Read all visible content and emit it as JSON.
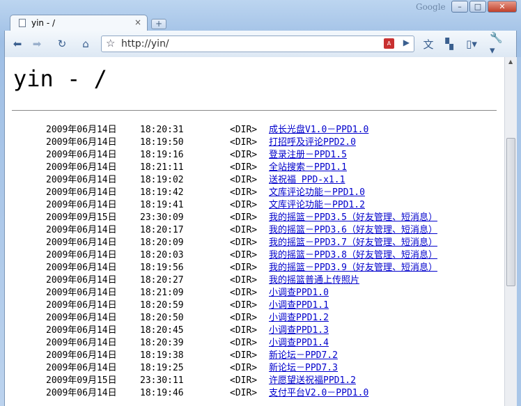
{
  "window": {
    "brand": "Google",
    "minimize": "–",
    "maximize": "□",
    "close": "✕"
  },
  "tab": {
    "title": "yin - /",
    "close": "×",
    "new_tab": "+"
  },
  "address": {
    "url": "http://yin/"
  },
  "page": {
    "title": "yin - /"
  },
  "entries": [
    {
      "date": "2009年06月14日",
      "time": "18:20:31",
      "type": "<DIR>",
      "name": "成长光盘V1.0－PPD1.0"
    },
    {
      "date": "2009年06月14日",
      "time": "18:19:50",
      "type": "<DIR>",
      "name": "打招呼及评论PPD2.0"
    },
    {
      "date": "2009年06月14日",
      "time": "18:19:16",
      "type": "<DIR>",
      "name": "登录注册－PPD1.5"
    },
    {
      "date": "2009年06月14日",
      "time": "18:21:11",
      "type": "<DIR>",
      "name": "全站搜索－PPD1.1"
    },
    {
      "date": "2009年06月14日",
      "time": "18:19:02",
      "type": "<DIR>",
      "name": "送祝福 PPD-x1.1"
    },
    {
      "date": "2009年06月14日",
      "time": "18:19:42",
      "type": "<DIR>",
      "name": "文库评论功能－PPD1.0"
    },
    {
      "date": "2009年06月14日",
      "time": "18:19:41",
      "type": "<DIR>",
      "name": "文库评论功能－PPD1.2"
    },
    {
      "date": "2009年09月15日",
      "time": "23:30:09",
      "type": "<DIR>",
      "name": "我的摇篮－PPD3.5（好友管理、短消息）"
    },
    {
      "date": "2009年06月14日",
      "time": "18:20:17",
      "type": "<DIR>",
      "name": "我的摇篮－PPD3.6（好友管理、短消息）"
    },
    {
      "date": "2009年06月14日",
      "time": "18:20:09",
      "type": "<DIR>",
      "name": "我的摇篮－PPD3.7（好友管理、短消息）"
    },
    {
      "date": "2009年06月14日",
      "time": "18:20:03",
      "type": "<DIR>",
      "name": "我的摇篮－PPD3.8（好友管理、短消息）"
    },
    {
      "date": "2009年06月14日",
      "time": "18:19:56",
      "type": "<DIR>",
      "name": "我的摇篮－PPD3.9（好友管理、短消息）"
    },
    {
      "date": "2009年06月14日",
      "time": "18:20:27",
      "type": "<DIR>",
      "name": "我的摇篮普通上传照片"
    },
    {
      "date": "2009年06月14日",
      "time": "18:21:09",
      "type": "<DIR>",
      "name": "小调查PPD1.0"
    },
    {
      "date": "2009年06月14日",
      "time": "18:20:59",
      "type": "<DIR>",
      "name": "小调查PPD1.1"
    },
    {
      "date": "2009年06月14日",
      "time": "18:20:50",
      "type": "<DIR>",
      "name": "小调查PPD1.2"
    },
    {
      "date": "2009年06月14日",
      "time": "18:20:45",
      "type": "<DIR>",
      "name": "小调查PPD1.3"
    },
    {
      "date": "2009年06月14日",
      "time": "18:20:39",
      "type": "<DIR>",
      "name": "小调查PPD1.4"
    },
    {
      "date": "2009年06月14日",
      "time": "18:19:38",
      "type": "<DIR>",
      "name": "新论坛－PPD7.2"
    },
    {
      "date": "2009年06月14日",
      "time": "18:19:25",
      "type": "<DIR>",
      "name": "新论坛－PPD7.3"
    },
    {
      "date": "2009年09月15日",
      "time": "23:30:11",
      "type": "<DIR>",
      "name": "许愿望送祝福PPD1.2"
    },
    {
      "date": "2009年06月14日",
      "time": "18:19:46",
      "type": "<DIR>",
      "name": "支付平台V2.0－PPD1.0"
    }
  ]
}
